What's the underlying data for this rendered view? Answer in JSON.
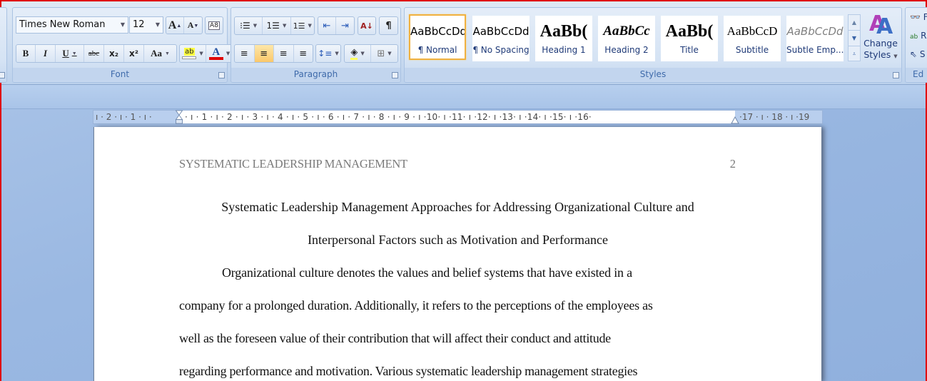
{
  "ribbon": {
    "font": {
      "label": "Font",
      "font_name": "Times New Roman",
      "font_size": "12",
      "grow_font": "A",
      "shrink_font": "A",
      "clear_formatting": "A8",
      "bold": "B",
      "italic": "I",
      "underline": "U",
      "strikethrough": "abc",
      "subscript": "x₂",
      "superscript": "x²",
      "change_case": "Aa",
      "highlight": "ab",
      "font_color": "A",
      "font_color_value": "#e00000"
    },
    "paragraph": {
      "label": "Paragraph",
      "bullets": "⁝☰",
      "numbering": "1☰",
      "multilevel": "1☰",
      "decrease_indent": "⇤",
      "increase_indent": "⇥",
      "sort": "A↓",
      "show_marks": "¶",
      "align_left": "≡",
      "align_center": "≡",
      "align_right": "≡",
      "justify": "≡",
      "active_alignment": "center",
      "line_spacing": "↕≡",
      "shading": "◈",
      "borders": "⊞"
    },
    "styles": {
      "label": "Styles",
      "items": [
        {
          "sample": "AaBbCcDd",
          "name": "¶ Normal",
          "selected": true
        },
        {
          "sample": "AaBbCcDd",
          "name": "¶ No Spacing",
          "selected": false
        },
        {
          "sample": "AaBb(",
          "name": "Heading 1",
          "selected": false
        },
        {
          "sample": "AaBbCc",
          "name": "Heading 2",
          "selected": false
        },
        {
          "sample": "AaBb(",
          "name": "Title",
          "selected": false
        },
        {
          "sample": "AaBbCcD",
          "name": "Subtitle",
          "selected": false
        },
        {
          "sample": "AaBbCcDd",
          "name": "Subtle Emp...",
          "selected": false
        }
      ],
      "change_styles_line1": "Change",
      "change_styles_line2": "Styles"
    },
    "editing": {
      "label": "Ed",
      "find": "F",
      "replace": "R",
      "select": "S"
    }
  },
  "ruler": {
    "left_margin_labels": "ı · 2 · ı · 1 · ı ·",
    "content_labels": "· ı · 1 · ı · 2 · ı · 3 · ı · 4 · ı · 5 · ı · 6 · ı · 7 · ı · 8 · ı · 9 · ı ·10· ı ·11· ı ·12· ı ·13· ı ·14· ı ·15· ı ·16·",
    "right_margin_labels": "·17 · ı · 18 · ı ·19"
  },
  "document": {
    "header": "SYSTEMATIC LEADERSHIP MANAGEMENT",
    "page_number": "2",
    "title_lines": [
      "Systematic Leadership Management Approaches for Addressing Organizational Culture and",
      "Interpersonal Factors such as Motivation and Performance"
    ],
    "body_lines": [
      "Organizational culture denotes the values and belief systems that have existed in a",
      "company for a prolonged duration. Additionally, it refers to the perceptions of the employees as",
      "well as the foreseen value of their contribution that will affect their conduct and attitude",
      "regarding performance and motivation. Various systematic leadership management strategies"
    ]
  }
}
